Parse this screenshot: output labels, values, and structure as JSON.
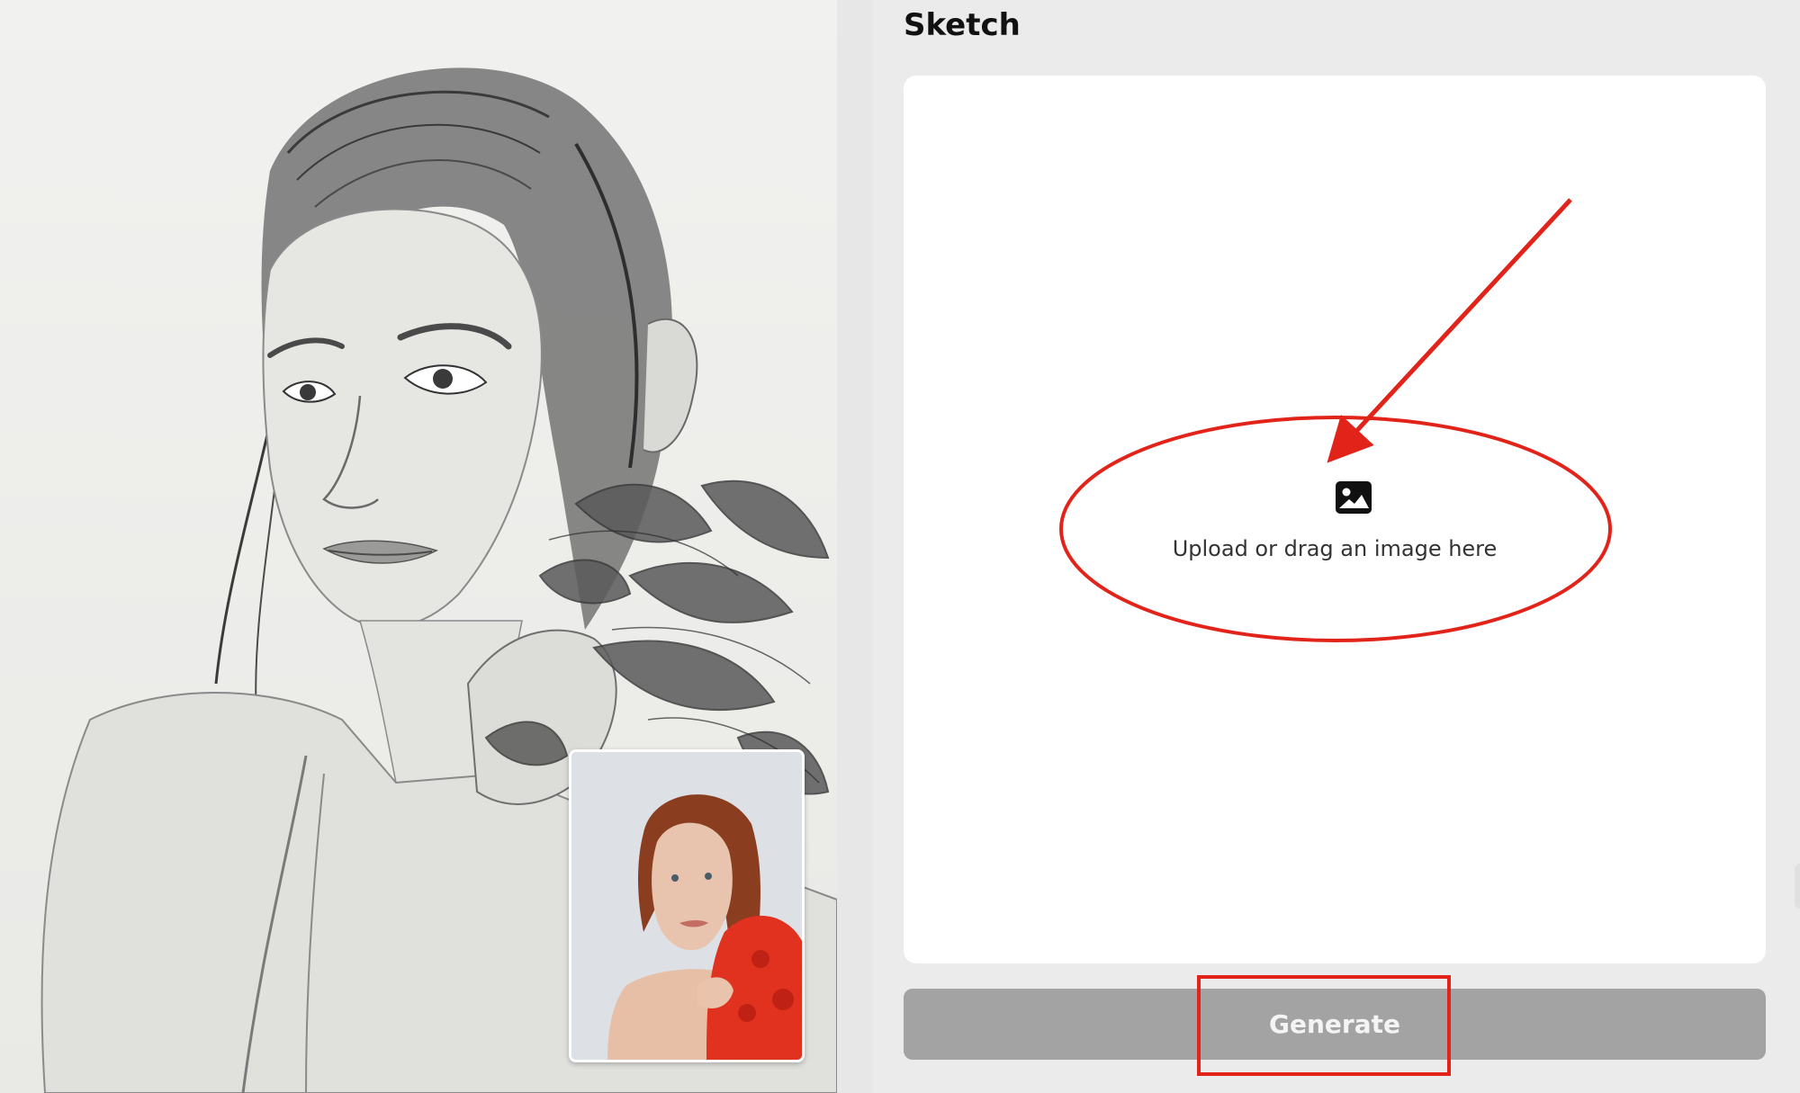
{
  "panel": {
    "title": "Sketch"
  },
  "upload": {
    "icon": "image-icon",
    "prompt": "Upload or drag an image here"
  },
  "actions": {
    "generate_label": "Generate"
  },
  "colors": {
    "panel_background": "#ebebeb",
    "dropzone_background": "#ffffff",
    "button_disabled": "#a3a3a3",
    "annotation_red": "#e2231a"
  },
  "annotations": [
    {
      "shape": "arrow",
      "target": "upload-dropzone"
    },
    {
      "shape": "ellipse",
      "target": "upload-prompt"
    },
    {
      "shape": "rectangle",
      "target": "generate-button"
    }
  ]
}
